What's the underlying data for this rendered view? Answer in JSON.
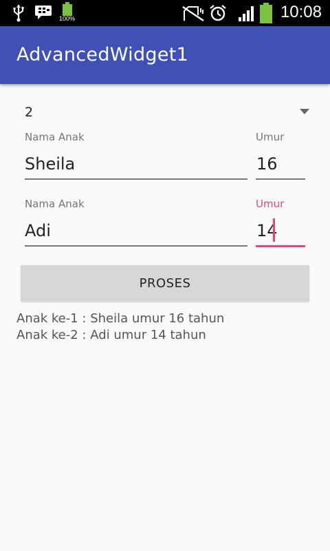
{
  "status_bar": {
    "time": "10:08",
    "battery_percent": "100%",
    "icons": [
      "usb-icon",
      "bbm-icon",
      "battery-icon",
      "no-sim-icon",
      "alarm-icon",
      "signal-icon",
      "battery-charging-icon"
    ]
  },
  "app_bar": {
    "title": "AdvancedWidget1",
    "color": "#3f51b5"
  },
  "spinner": {
    "selected_value": "2"
  },
  "rows": [
    {
      "name_label": "Nama Anak",
      "name_value": "Sheila",
      "age_label": "Umur",
      "age_value": "16"
    },
    {
      "name_label": "Nama Anak",
      "name_value": "Adi",
      "age_label": "Umur",
      "age_value": "14"
    }
  ],
  "button": {
    "label": "PROSES"
  },
  "results": [
    "Anak ke-1 : Sheila umur 16 tahun",
    "Anak ke-2 : Adi umur 14 tahun"
  ],
  "colors": {
    "accent": "#e8437c",
    "primary": "#3f51b5"
  }
}
